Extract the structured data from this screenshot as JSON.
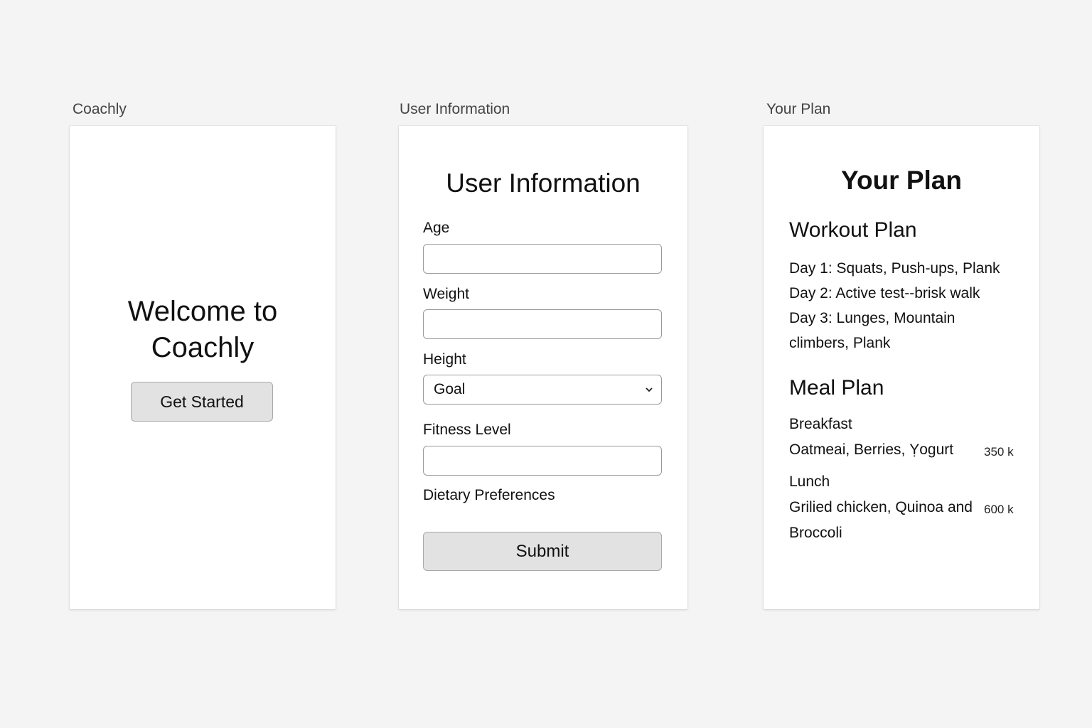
{
  "screens": {
    "welcome": {
      "frame_label": "Coachly",
      "heading": "Welcome to\nCoachly",
      "button_label": "Get Started"
    },
    "user_info": {
      "frame_label": "User Information",
      "title": "User Information",
      "fields": [
        {
          "label": "Age",
          "value": ""
        },
        {
          "label": "Weight",
          "value": ""
        },
        {
          "label": "Height",
          "selected": "Goal"
        },
        {
          "label": "Fitness Level",
          "value": ""
        },
        {
          "label": "Dietary Preferences"
        }
      ],
      "submit_label": "Submit"
    },
    "plan": {
      "frame_label": "Your Plan",
      "title": "Your Plan",
      "workout_heading": "Workout Plan",
      "workout_days": [
        "Day 1: Squats, Push-ups, Plank",
        "Day 2: Active test--brisk walk",
        "Day 3: Lunges, Mountain climbers, Plank"
      ],
      "meal_heading": "Meal Plan",
      "meals": [
        {
          "name": "Breakfast",
          "description": "Oatmeai, Berries, Ỵogurt",
          "kcal": "350 k"
        },
        {
          "name": "Lunch",
          "description": "Grilied chicken, Quinoa and Broccoli",
          "kcal": "600 k"
        }
      ]
    }
  }
}
